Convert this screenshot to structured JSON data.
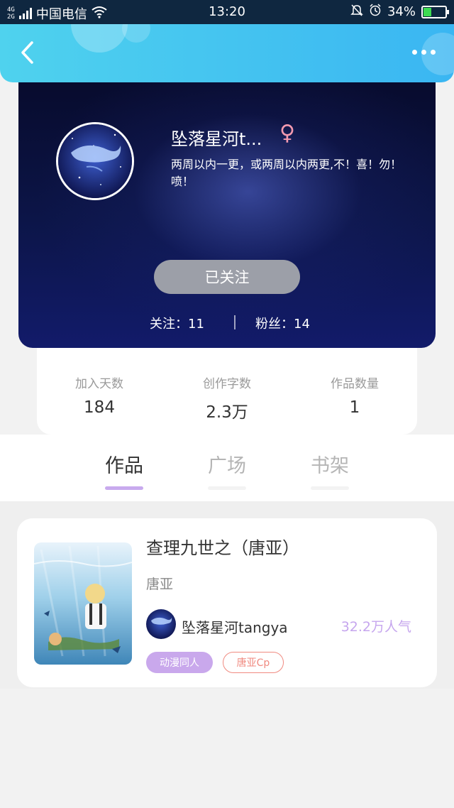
{
  "status_bar": {
    "network": "4G",
    "network2": "2G",
    "carrier": "中国电信",
    "time": "13:20",
    "battery": "34%",
    "battery_level": 0.34,
    "icons": [
      "signal-icon",
      "wifi-icon",
      "mute-icon",
      "alarm-icon",
      "battery-icon"
    ]
  },
  "nav": {
    "back_icon": "chevron-left-icon",
    "more_icon": "more-dots-icon",
    "colors": {
      "from": "#4fd2ee",
      "to": "#3ab6f2"
    }
  },
  "profile": {
    "nickname": "坠落星河t...",
    "gender_symbol": "♀",
    "bio": "两周以内一更，或两周以内两更,不！喜！勿！喷！",
    "follow_button": "已关注",
    "following_label": "关注：11",
    "fans_label": "粉丝：14"
  },
  "stats": [
    {
      "label": "加入天数",
      "value": "184"
    },
    {
      "label": "创作字数",
      "value": "2.3万"
    },
    {
      "label": "作品数量",
      "value": "1"
    }
  ],
  "tabs": [
    {
      "label": "作品",
      "active": true
    },
    {
      "label": "广场",
      "active": false
    },
    {
      "label": "书架",
      "active": false
    }
  ],
  "works": [
    {
      "title": "查理九世之（唐亚）",
      "subtitle": "唐亚",
      "author": "坠落星河tangya",
      "popularity": "32.2万人气",
      "tags": [
        "动漫同人",
        "唐亚Cp"
      ]
    }
  ],
  "colors": {
    "accent_purple": "#c8aaee",
    "tag_red": "#f08a80",
    "gender_pink": "#f49ab0"
  }
}
